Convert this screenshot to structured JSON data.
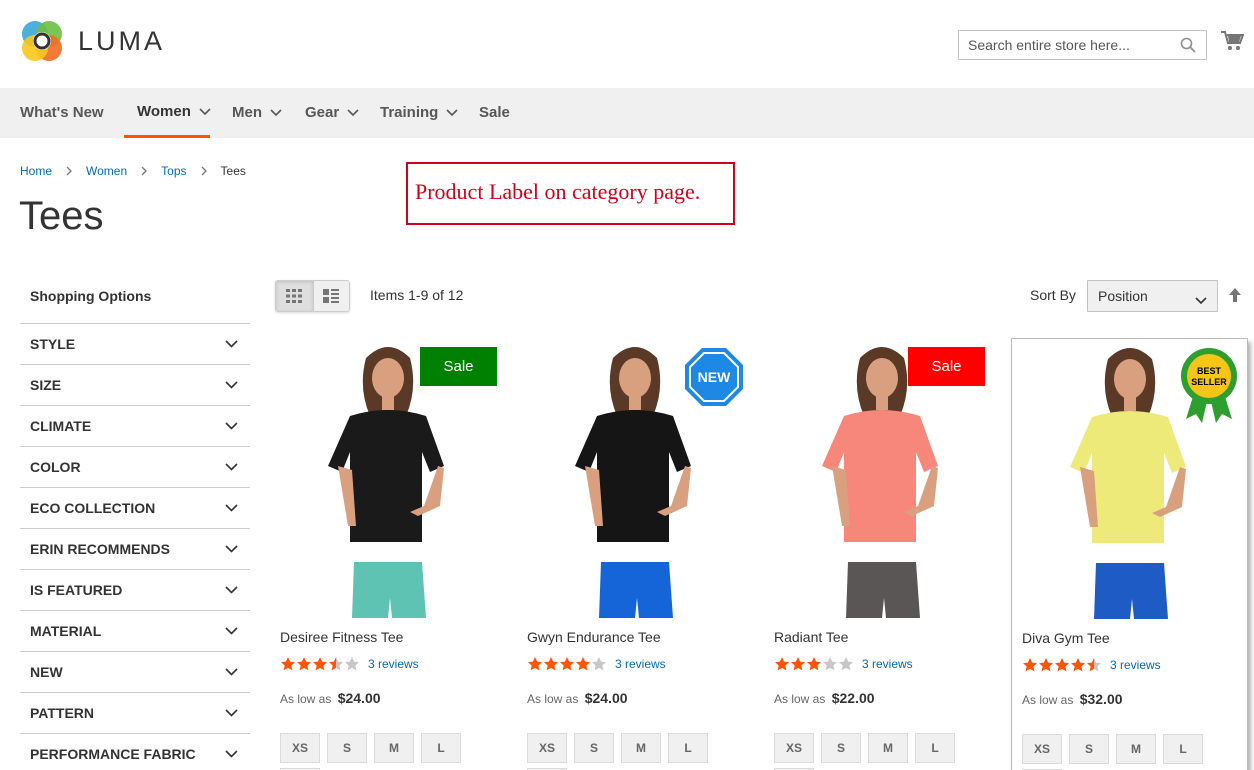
{
  "header": {
    "brand": "LUMA",
    "search_placeholder": "Search entire store here..."
  },
  "nav": [
    {
      "label": "What's New",
      "has_submenu": false,
      "active": false
    },
    {
      "label": "Women",
      "has_submenu": true,
      "active": true
    },
    {
      "label": "Men",
      "has_submenu": true,
      "active": false
    },
    {
      "label": "Gear",
      "has_submenu": true,
      "active": false
    },
    {
      "label": "Training",
      "has_submenu": true,
      "active": false
    },
    {
      "label": "Sale",
      "has_submenu": false,
      "active": false
    }
  ],
  "breadcrumb": [
    "Home",
    "Women",
    "Tops",
    "Tees"
  ],
  "page_title": "Tees",
  "annotation": "Product Label on category page.",
  "sidebar": {
    "title": "Shopping Options",
    "filters": [
      "Style",
      "Size",
      "Climate",
      "Color",
      "Eco Collection",
      "Erin Recommends",
      "Is Featured",
      "Material",
      "New",
      "Pattern",
      "Performance Fabric"
    ]
  },
  "toolbar": {
    "items_count": "Items 1-9 of 12",
    "sort_label": "Sort By",
    "sort_value": "Position"
  },
  "products": [
    {
      "name": "Desiree Fitness Tee",
      "rating": 3.5,
      "reviews": "3 reviews",
      "price_prefix": "As low as",
      "price": "$24.00",
      "label": "Sale",
      "label_color": "#008000",
      "shirt": "#1a1a1a",
      "bottom": "#5fc3b3"
    },
    {
      "name": "Gwyn Endurance Tee",
      "rating": 4,
      "reviews": "3 reviews",
      "price_prefix": "As low as",
      "price": "$24.00",
      "label": "NEW",
      "label_color": "#1e88e5",
      "shirt": "#151515",
      "bottom": "#1565d8"
    },
    {
      "name": "Radiant Tee",
      "rating": 3,
      "reviews": "3 reviews",
      "price_prefix": "As low as",
      "price": "$22.00",
      "label": "Sale",
      "label_color": "#ff0000",
      "shirt": "#f6877a",
      "bottom": "#5a5655"
    },
    {
      "name": "Diva Gym Tee",
      "rating": 4.5,
      "reviews": "3 reviews",
      "price_prefix": "As low as",
      "price": "$32.00",
      "label": "BEST SELLER",
      "label_color": "#f5c518",
      "shirt": "#eeea7a",
      "bottom": "#1f5bc4"
    }
  ],
  "sizes": [
    "XS",
    "S",
    "M",
    "L"
  ],
  "colors": {
    "accent": "#ff5501",
    "link": "#006bb4",
    "star": "#ff5501",
    "star_empty": "#c7c7c7"
  }
}
